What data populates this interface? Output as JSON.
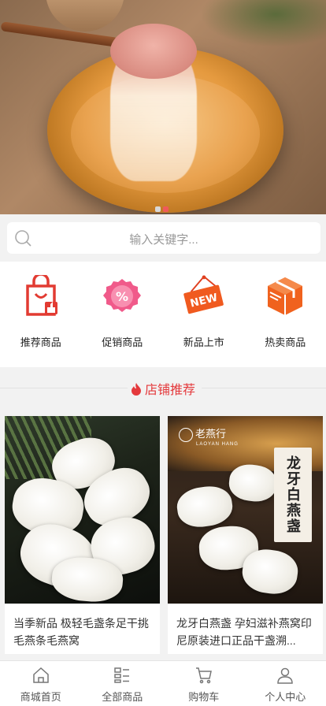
{
  "banner": {
    "slides": 2,
    "active_slide": 2
  },
  "search": {
    "placeholder": "输入关键字..."
  },
  "categories": [
    {
      "label": "推荐商品",
      "icon": "shopping-bag-thumb-icon"
    },
    {
      "label": "促销商品",
      "icon": "percent-badge-icon"
    },
    {
      "label": "新品上市",
      "icon": "new-sign-icon"
    },
    {
      "label": "热卖商品",
      "icon": "package-box-icon"
    }
  ],
  "section": {
    "title": "店铺推荐",
    "icon": "flame-icon",
    "accent": "#e4393c"
  },
  "products": [
    {
      "title": "当季新品 极轻毛盏条足干挑毛燕条毛燕窝"
    },
    {
      "title": "龙牙白燕盏 孕妇滋补燕窝印尼原装进口正品干盏溯...",
      "image_brand": "老燕行",
      "image_brand_sub": "LAOYAN HANG",
      "image_tag": "龙牙白燕盏"
    }
  ],
  "bottom_nav": [
    {
      "label": "商城首页",
      "icon": "home-icon"
    },
    {
      "label": "全部商品",
      "icon": "category-grid-icon"
    },
    {
      "label": "购物车",
      "icon": "cart-icon"
    },
    {
      "label": "个人中心",
      "icon": "user-icon"
    }
  ]
}
